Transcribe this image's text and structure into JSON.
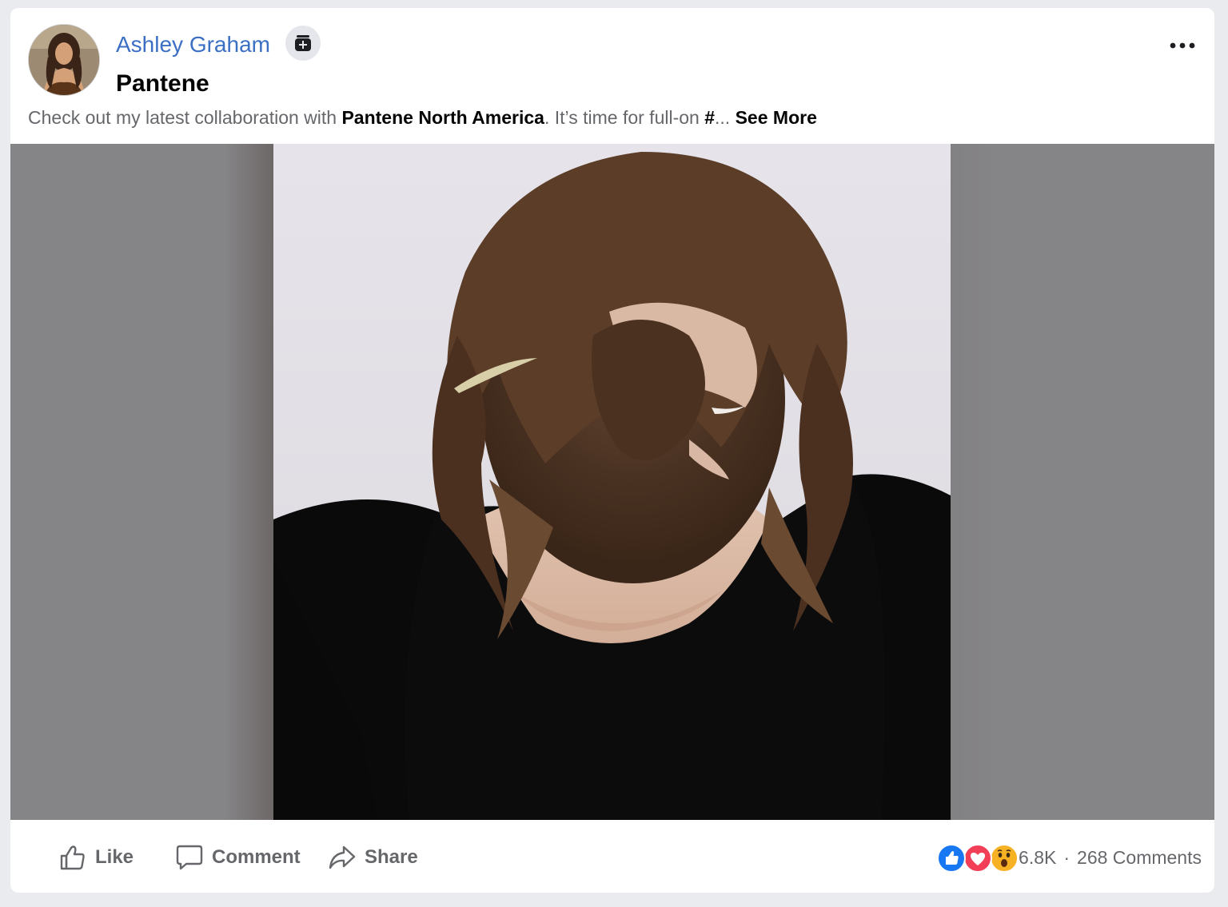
{
  "post": {
    "author": "Ashley Graham",
    "page_name": "Pantene",
    "caption": {
      "prefix": "Check out my latest collaboration with ",
      "mention": "Pantene North America",
      "middle": ". It’s time for full-on ",
      "hashtag_start": "#",
      "ellipsis": "...",
      "see_more": "See More"
    },
    "icons": {
      "badge": "ad-library-icon",
      "menu": "more-options-icon"
    }
  },
  "actions": {
    "like": "Like",
    "comment": "Comment",
    "share": "Share"
  },
  "stats": {
    "reaction_icons": [
      "like-reaction-icon",
      "love-reaction-icon",
      "wow-reaction-icon"
    ],
    "reaction_count": "6.8K",
    "separator": "·",
    "comments": "268 Comments"
  },
  "colors": {
    "author_link": "#3b6fc4",
    "like_blue": "#1877f2",
    "love_red": "#f33e58",
    "wow_yellow": "#f7b125"
  }
}
